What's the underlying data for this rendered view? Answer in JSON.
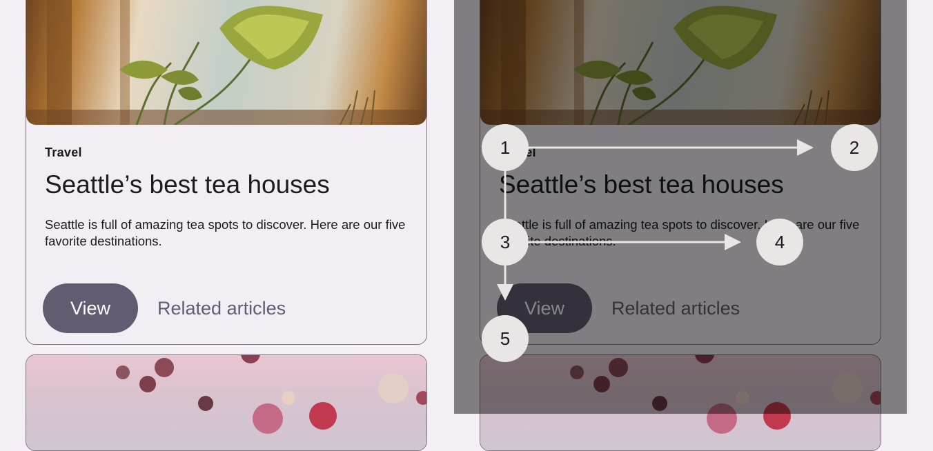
{
  "card": {
    "eyebrow": "Travel",
    "headline": "Seattle’s best tea houses",
    "supporting_text": "Seattle is full of amazing tea spots to discover. Here are our five favorite destinations.",
    "primary_action": "View",
    "secondary_action": "Related articles"
  },
  "annotations": {
    "markers": [
      "1",
      "2",
      "3",
      "4",
      "5"
    ]
  },
  "colors": {
    "primary": "#625b71",
    "surface": "#f2eef3",
    "outline": "#7a757f",
    "scrim": "rgba(0,0,0,0.47)",
    "marker": "#e9e6e6"
  }
}
